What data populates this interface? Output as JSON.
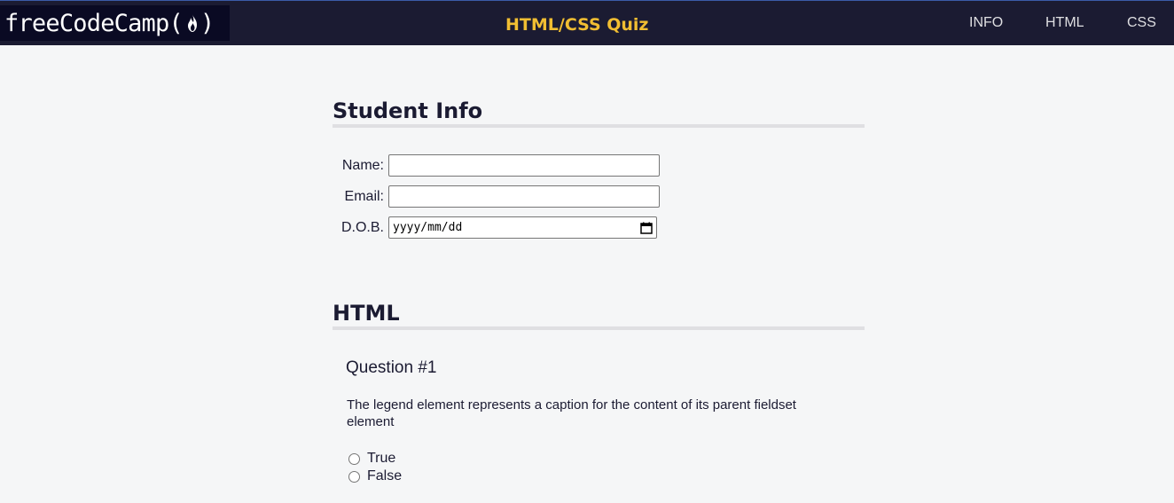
{
  "header": {
    "logo_text": "freeCodeCamp(",
    "logo_close": ")",
    "title": "HTML/CSS Quiz",
    "nav": [
      {
        "label": "INFO"
      },
      {
        "label": "HTML"
      },
      {
        "label": "CSS"
      }
    ]
  },
  "student_info": {
    "heading": "Student Info",
    "fields": [
      {
        "label": "Name:",
        "value": ""
      },
      {
        "label": "Email:",
        "value": ""
      },
      {
        "label": "D.O.B.",
        "value": "yyyy/mm/dd"
      }
    ]
  },
  "html_section": {
    "heading": "HTML",
    "question_title": "Question #1",
    "question_text": "The legend element represents a caption for the content of its parent fieldset element",
    "options": [
      {
        "label": "True"
      },
      {
        "label": "False"
      }
    ]
  },
  "colors": {
    "header_bg": "#1b1b32",
    "title_accent": "#f1be32",
    "page_bg": "#f5f6f7"
  }
}
